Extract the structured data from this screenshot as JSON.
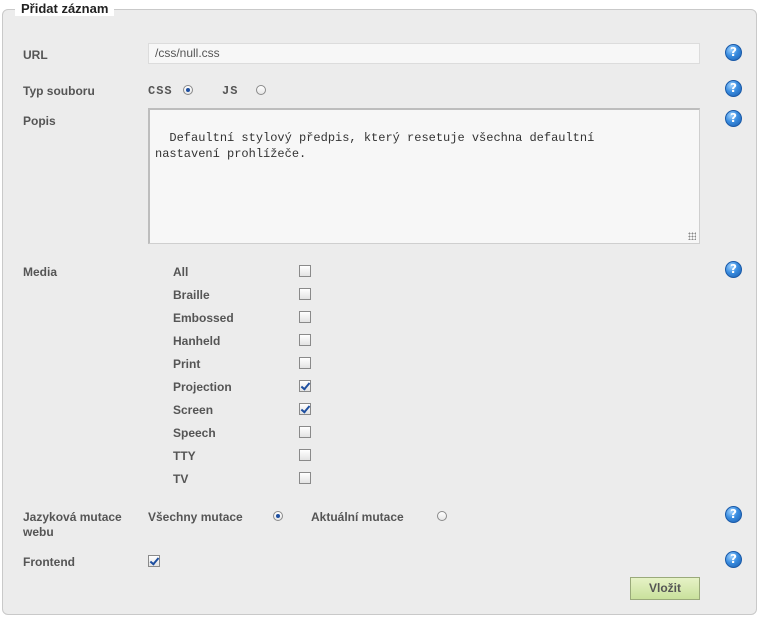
{
  "form": {
    "title": "Přidat záznam",
    "url": {
      "label": "URL",
      "value": "/css/null.css"
    },
    "file_type": {
      "label": "Typ souboru",
      "options": [
        {
          "label": "CSS",
          "checked": true
        },
        {
          "label": "JS",
          "checked": false
        }
      ]
    },
    "description": {
      "label": "Popis",
      "value": "Defaultní stylový předpis, který resetuje všechna defaultní\nnastavení prohlížeče."
    },
    "media": {
      "label": "Media",
      "items": [
        {
          "label": "All",
          "checked": false
        },
        {
          "label": "Braille",
          "checked": false
        },
        {
          "label": "Embossed",
          "checked": false
        },
        {
          "label": "Hanheld",
          "checked": false
        },
        {
          "label": "Print",
          "checked": false
        },
        {
          "label": "Projection",
          "checked": true
        },
        {
          "label": "Screen",
          "checked": true
        },
        {
          "label": "Speech",
          "checked": false
        },
        {
          "label": "TTY",
          "checked": false
        },
        {
          "label": "TV",
          "checked": false
        }
      ]
    },
    "language": {
      "label_line1": "Jazyková mutace",
      "label_line2": "webu",
      "options": [
        {
          "label": "Všechny mutace",
          "checked": true
        },
        {
          "label": "Aktuální mutace",
          "checked": false
        }
      ]
    },
    "frontend": {
      "label": "Frontend",
      "checked": true
    },
    "help_icon": "question-mark-icon",
    "help_glyph": "?",
    "submit_label": "Vložit"
  }
}
